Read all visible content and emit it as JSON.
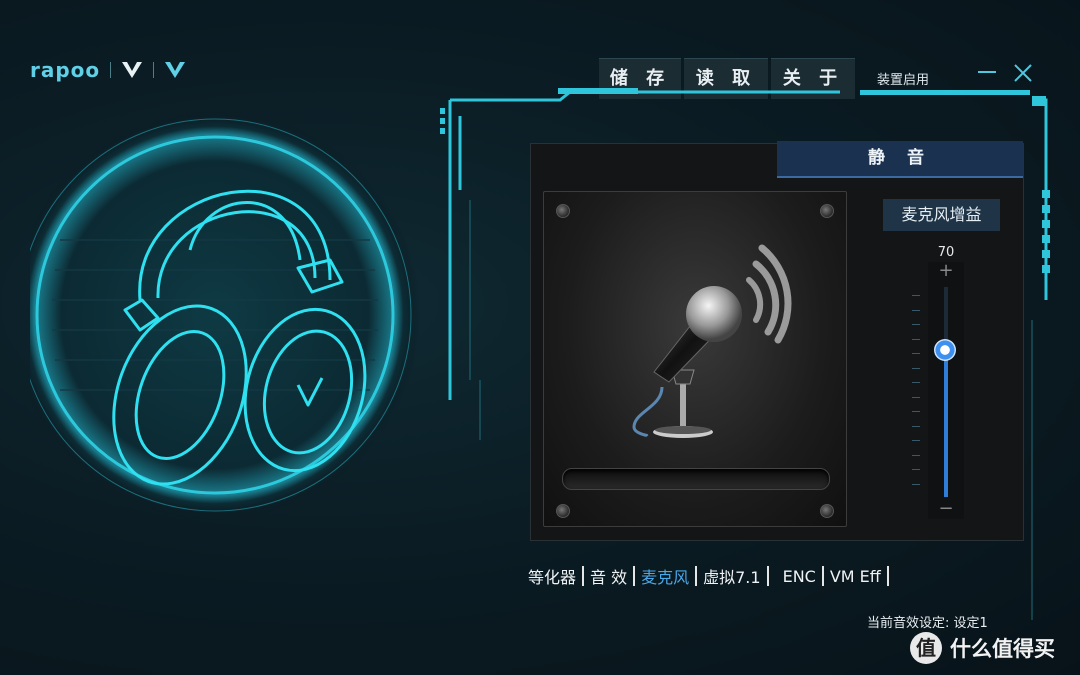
{
  "brand": {
    "name": "rapoo"
  },
  "toolbar": {
    "save_label": "储 存",
    "load_label": "读 取",
    "about_label": "关 于",
    "device_enable_label": "装置启用"
  },
  "mute": {
    "label": "静 音"
  },
  "mic_gain": {
    "label": "麦克风增益",
    "value": "70",
    "plus": "+",
    "minus": "−",
    "level": 0.7
  },
  "tabs": [
    {
      "label": "等化器",
      "active": false
    },
    {
      "label": "音 效",
      "active": false
    },
    {
      "label": "麦克风",
      "active": true
    },
    {
      "label": "虚拟7.1",
      "active": false
    },
    {
      "label": "ENC",
      "active": false
    },
    {
      "label": "VM Eff",
      "active": false
    }
  ],
  "status": {
    "current_preset": "当前音效设定: 设定1"
  },
  "watermark": {
    "icon": "值",
    "text": "什么值得买"
  },
  "colors": {
    "accent": "#2fd2e6",
    "active_tab": "#49a8e8",
    "slider": "#2e7dd8"
  }
}
